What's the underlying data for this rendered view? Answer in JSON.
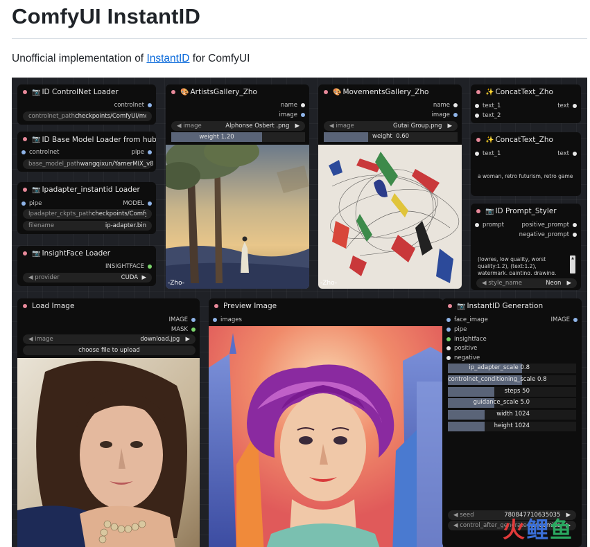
{
  "page": {
    "title": "ComfyUI InstantID",
    "subtitle_prefix": "Unofficial implementation of ",
    "subtitle_link": "InstantID",
    "subtitle_suffix": " for ComfyUI"
  },
  "nodes": {
    "controlnet_loader": {
      "title": "ID ControlNet Loader",
      "out_label": "controlnet",
      "field_label": "controlnet_path",
      "field_value": "checkpoints/ComfyUI/models/contro"
    },
    "base_model_loader": {
      "title": "ID Base Model Loader from hub 🤗",
      "in_label": "controlnet",
      "out_label": "pipe",
      "field_label": "base_model_path",
      "field_value": "wangqixun/YamerMIX_v8"
    },
    "ipadapter_loader": {
      "title": "Ipadapter_instantid Loader",
      "in_label": "pipe",
      "out_label": "MODEL",
      "field1_label": "Ipadapter_ckpts_path",
      "field1_value": "checkpoints/ComfyUI/models/checkp",
      "field2_label": "filename",
      "field2_value": "ip-adapter.bin"
    },
    "insightface_loader": {
      "title": "InsightFace Loader",
      "out_label": "INSIGHTFACE",
      "provider_label": "provider",
      "provider_value": "CUDA"
    },
    "artists_gallery": {
      "title": "ArtistsGallery_Zho",
      "out1": "name",
      "out2": "image",
      "image_label": "image",
      "image_value": "Alphonse Osbert .png",
      "weight_text": "weight  1.20",
      "weight": 0.6,
      "watermark": "-Zho-"
    },
    "movements_gallery": {
      "title": "MovementsGallery_Zho",
      "out1": "name",
      "out2": "image",
      "image_label": "image",
      "image_value": "Gutai Group.png",
      "weight_label": "weight",
      "weight_value": "0.60",
      "weight": 0.3,
      "watermark": "-Zho-"
    },
    "concat_text_1": {
      "title": "ConcatText_Zho",
      "in1": "text_1",
      "in2": "text_2",
      "out": "text"
    },
    "concat_text_2": {
      "title": "ConcatText_Zho",
      "in1": "text_1",
      "out": "text",
      "body": "a woman, retro futurism, retro game"
    },
    "prompt_styler": {
      "title": "ID Prompt_Styler",
      "in1": "prompt",
      "out1": "positive_prompt",
      "out2": "negative_prompt",
      "body": "(lowres, low quality, worst quality:1.2), (text:1.2), watermark, painting, drawing, illustration, glitch, deformed",
      "style_label": "style_name",
      "style_value": "Neon"
    },
    "load_image": {
      "title": "Load Image",
      "out1": "IMAGE",
      "out2": "MASK",
      "image_label": "image",
      "image_value": "download.jpg",
      "upload_label": "choose file to upload"
    },
    "preview_image": {
      "title": "Preview Image",
      "in1": "images"
    },
    "instantid_generation": {
      "title": "InstantID Generation",
      "out": "IMAGE",
      "inputs": [
        "face_image",
        "pipe",
        "insightface",
        "positive",
        "negative"
      ],
      "sliders": [
        {
          "label": "ip_adapter_scale",
          "value": "0.8",
          "fill": 0.8
        },
        {
          "label": "controlnet_conditioning_scale",
          "value": "0.8",
          "fill": 0.8
        },
        {
          "label": "steps",
          "value": "50",
          "fill": 0.5
        },
        {
          "label": "guidance_scale",
          "value": "5.0",
          "fill": 0.5
        },
        {
          "label": "width",
          "value": "1024",
          "fill": 0.4
        },
        {
          "label": "height",
          "value": "1024",
          "fill": 0.4
        }
      ],
      "seed_label": "seed",
      "seed_value": "780847710635035",
      "control_label": "control_after_generate",
      "control_value": "randomize"
    }
  },
  "watermark_logo": "火鲤鱼",
  "colors": {
    "canvas_bg": "#1f2126",
    "node_bg": "#0d0d0d",
    "slot_pink": "#e8899a",
    "slot_blue": "#8fb4e8",
    "slot_green": "#7bd36b",
    "slider_fill": "#5a6478",
    "link": "#0969da"
  }
}
